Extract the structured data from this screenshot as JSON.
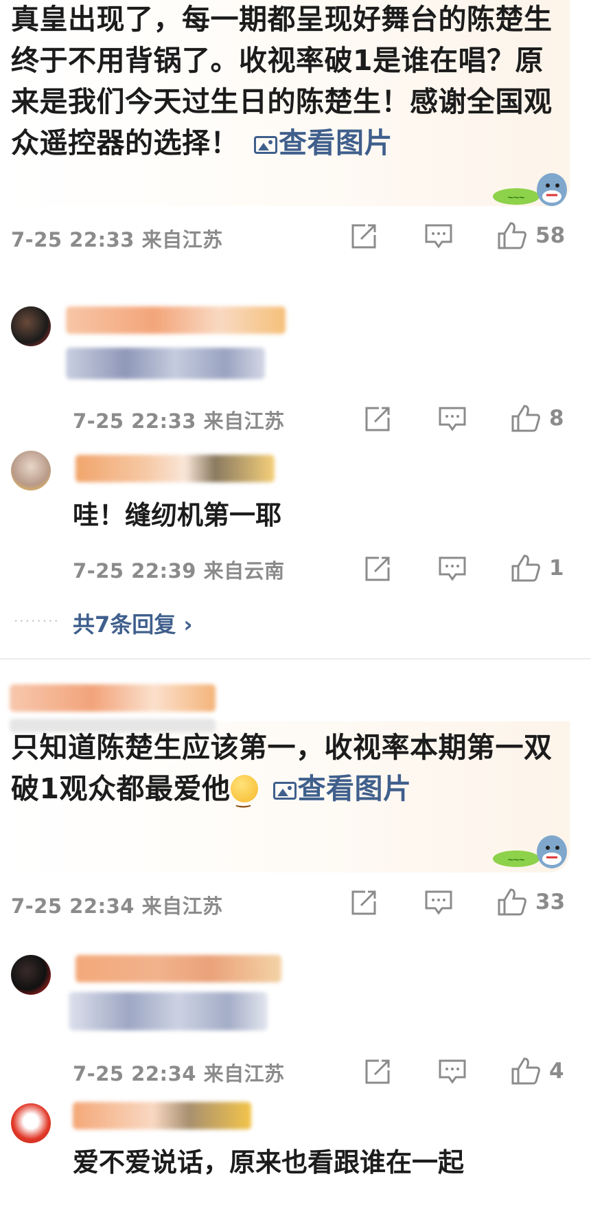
{
  "comments": [
    {
      "text": "真皇出现了，每一期都呈现好舞台的陈楚生终于不用背锅了。收视率破1是谁在唱？原来是我们今天过生日的陈楚生！感谢全国观众遥控器的选择！",
      "image_link": "查看图片",
      "time_location": "7-25 22:33 来自江苏",
      "likes": "58",
      "replies": [
        {
          "time_location": "7-25 22:33 来自江苏",
          "likes": "8"
        },
        {
          "text": "哇！缝纫机第一耶",
          "time_location": "7-25 22:39 来自云南",
          "likes": "1"
        }
      ],
      "more_replies": "共7条回复 ›"
    },
    {
      "text": "只知道陈楚生应该第一，收视率本期第一双破1观众都最爱他",
      "image_link": "查看图片",
      "time_location": "7-25 22:34 来自江苏",
      "likes": "33",
      "replies": [
        {
          "time_location": "7-25 22:34 来自江苏",
          "likes": "4"
        },
        {
          "text": "爱不爱说话，原来也看跟谁在一起"
        }
      ]
    }
  ],
  "icons": {
    "share": "share-icon",
    "comment": "comment-icon",
    "like": "like-icon",
    "image": "image-icon",
    "sticker": "shark-sticker",
    "emoji": "smile-emoji-icon"
  },
  "colors": {
    "link": "#3f5f8c",
    "meta": "#8b8b8b",
    "bubble": "#fdf4ea"
  }
}
